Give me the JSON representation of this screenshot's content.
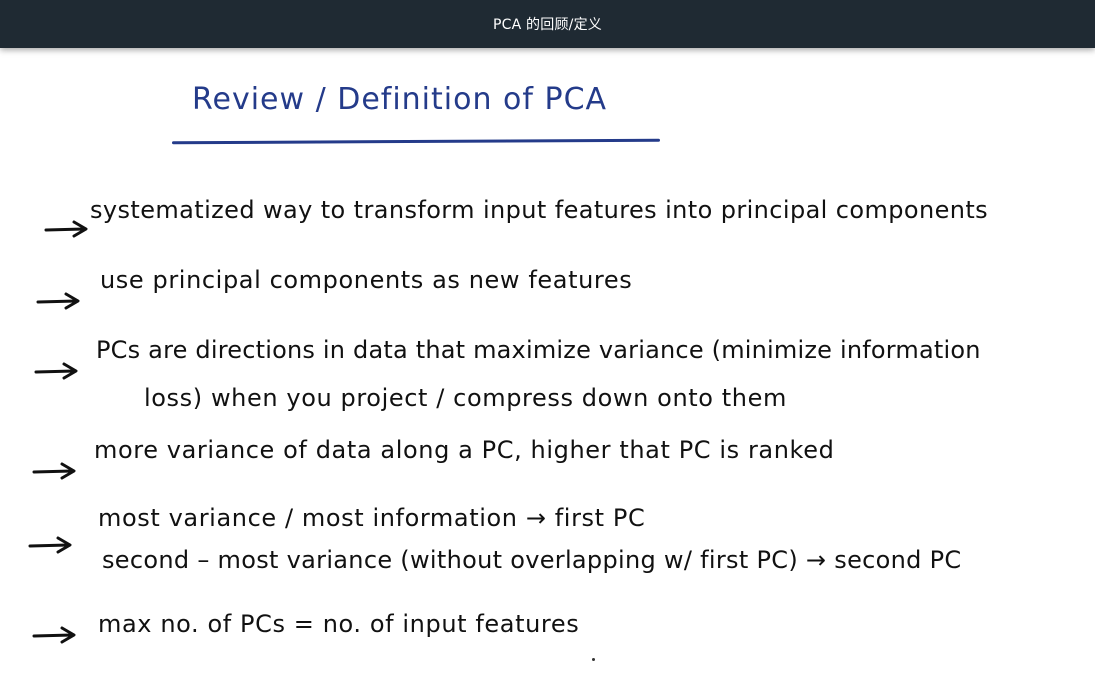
{
  "window": {
    "title": "PCA 的回顾/定义"
  },
  "board": {
    "heading": "Review / Definition of PCA",
    "lines": [
      "systematized way to transform input features into principal components",
      "use principal components as new features",
      "PCs are directions in data that maximize variance (minimize information",
      "loss) when you project / compress down onto them",
      "more variance of data along a PC, higher that PC is ranked",
      "most variance / most information → first PC",
      "second – most variance (without overlapping w/ first PC) → second PC",
      "max no. of PCs = no. of input features"
    ]
  },
  "icons": {
    "bullet": "arrow-right-icon"
  },
  "colors": {
    "titlebar_bg": "#1f2a33",
    "heading_ink": "#243b8a",
    "body_ink": "#111111"
  }
}
